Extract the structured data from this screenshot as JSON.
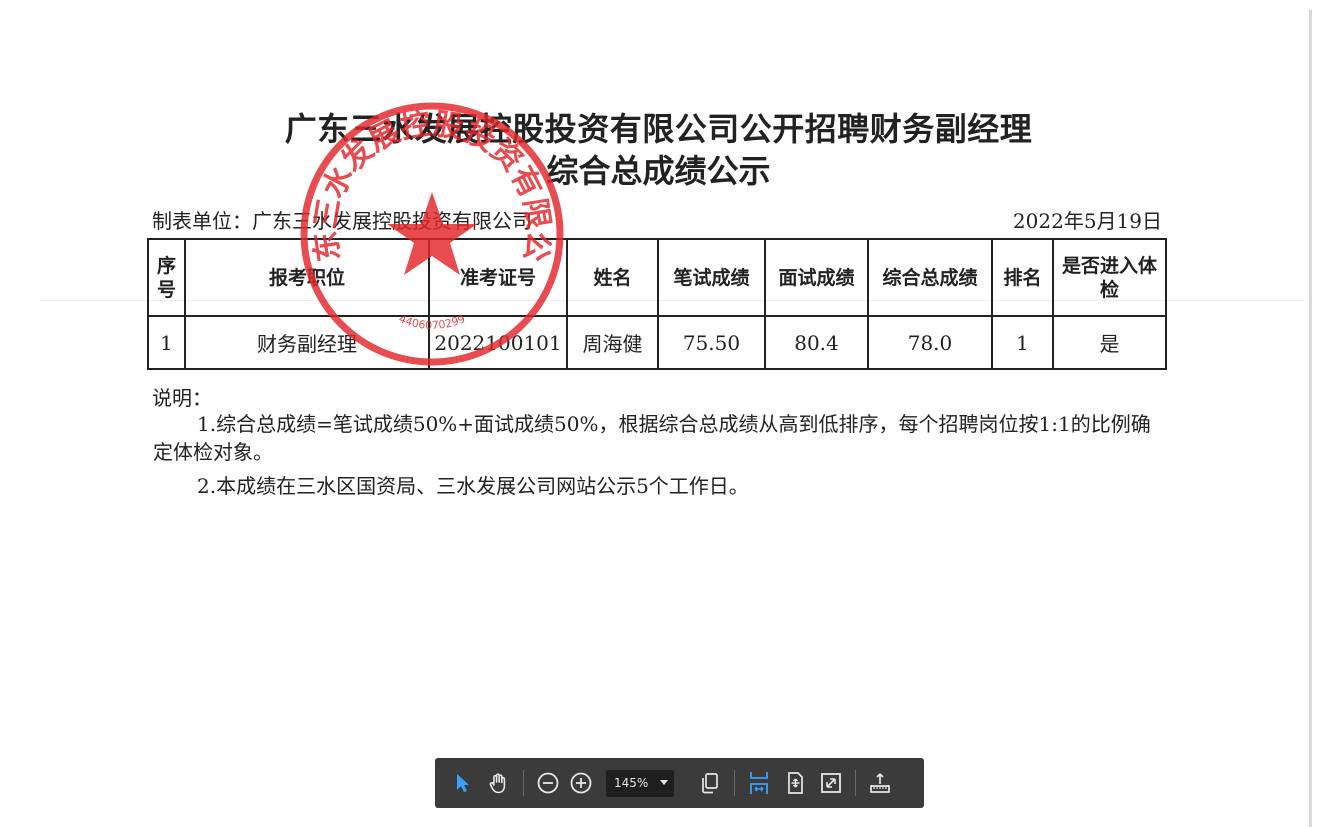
{
  "document": {
    "title_line1": "广东三水发展控股投资有限公司公开招聘财务副经理",
    "title_line2": "综合总成绩公示",
    "maker": "制表单位：广东三水发展控股投资有限公司",
    "date": "2022年5月19日",
    "table": {
      "headers": [
        "序号",
        "报考职位",
        "准考证号",
        "姓名",
        "笔试成绩",
        "面试成绩",
        "综合总成绩",
        "排名",
        "是否进入体检"
      ],
      "rows": [
        [
          "1",
          "财务副经理",
          "2022100101",
          "周海健",
          "75.50",
          "80.4",
          "78.0",
          "1",
          "是"
        ]
      ]
    },
    "notes_heading": "说明：",
    "note_1": "1.综合总成绩=笔试成绩50%+面试成绩50%，根据综合总成绩从高到低排序，每个招聘岗位按1:1的比例确定体检对象。",
    "note_2": "2.本成绩在三水区国资局、三水发展公司网站公示5个工作日。",
    "seal_text": "广东三水发展控股投资有限公司",
    "seal_number": "4406070299"
  },
  "toolbar": {
    "zoom_level": "145%",
    "accent_color": "#3aa0ff",
    "icon_color": "#e8e8e8",
    "icons": [
      "select-arrow-icon",
      "hand-pan-icon",
      "zoom-out-icon",
      "zoom-in-icon",
      "chevron-down-icon",
      "page-copy-icon",
      "fit-width-icon",
      "fit-page-icon",
      "fullscreen-icon",
      "presentation-icon"
    ]
  },
  "colors": {
    "seal_red": "#e3262a",
    "toolbar_bg": "#3b3b3b"
  }
}
